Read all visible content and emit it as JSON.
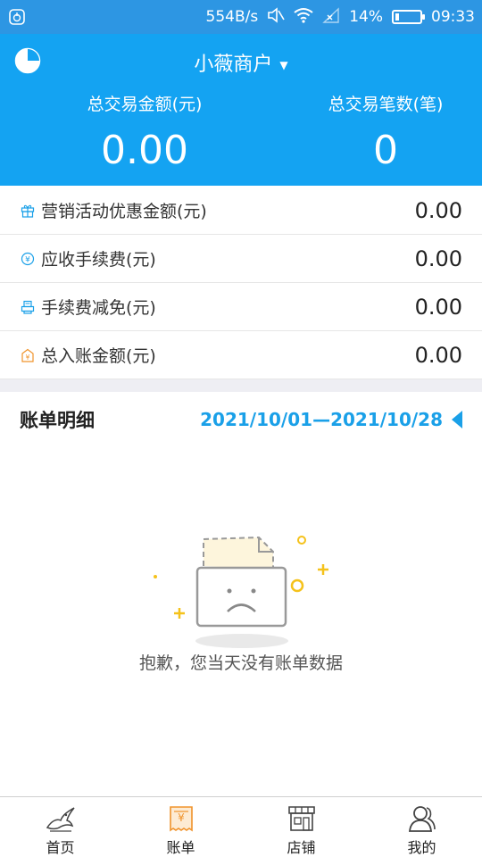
{
  "status_bar": {
    "speed": "554B/s",
    "battery": "14%",
    "battery_level": 0.14,
    "time": "09:33"
  },
  "header": {
    "merchant": "小薇商户",
    "total_amount_label": "总交易金额(元)",
    "total_amount": "0.00",
    "total_count_label": "总交易笔数(笔)",
    "total_count": "0"
  },
  "summary": [
    {
      "icon": "gift-icon",
      "label": "营销活动优惠金额(元)",
      "value": "0.00"
    },
    {
      "icon": "yen-coin-icon",
      "label": "应收手续费(元)",
      "value": "0.00"
    },
    {
      "icon": "receipt-printer-icon",
      "label": "手续费减免(元)",
      "value": "0.00"
    },
    {
      "icon": "money-bag-icon",
      "label": "总入账金额(元)",
      "value": "0.00"
    }
  ],
  "bill": {
    "title": "账单明细",
    "date_range": "2021/10/01—2021/10/28",
    "empty_message": "抱歉，您当天没有账单数据"
  },
  "tabs": [
    {
      "label": "首页",
      "icon": "home-bird-icon"
    },
    {
      "label": "账单",
      "icon": "bill-icon"
    },
    {
      "label": "店铺",
      "icon": "store-icon"
    },
    {
      "label": "我的",
      "icon": "user-icon"
    }
  ],
  "colors": {
    "brand_blue": "#14a3f2",
    "status_blue": "#2d96e3",
    "accent_blue": "#1aa0e8",
    "active_tab": "#f0932b"
  }
}
